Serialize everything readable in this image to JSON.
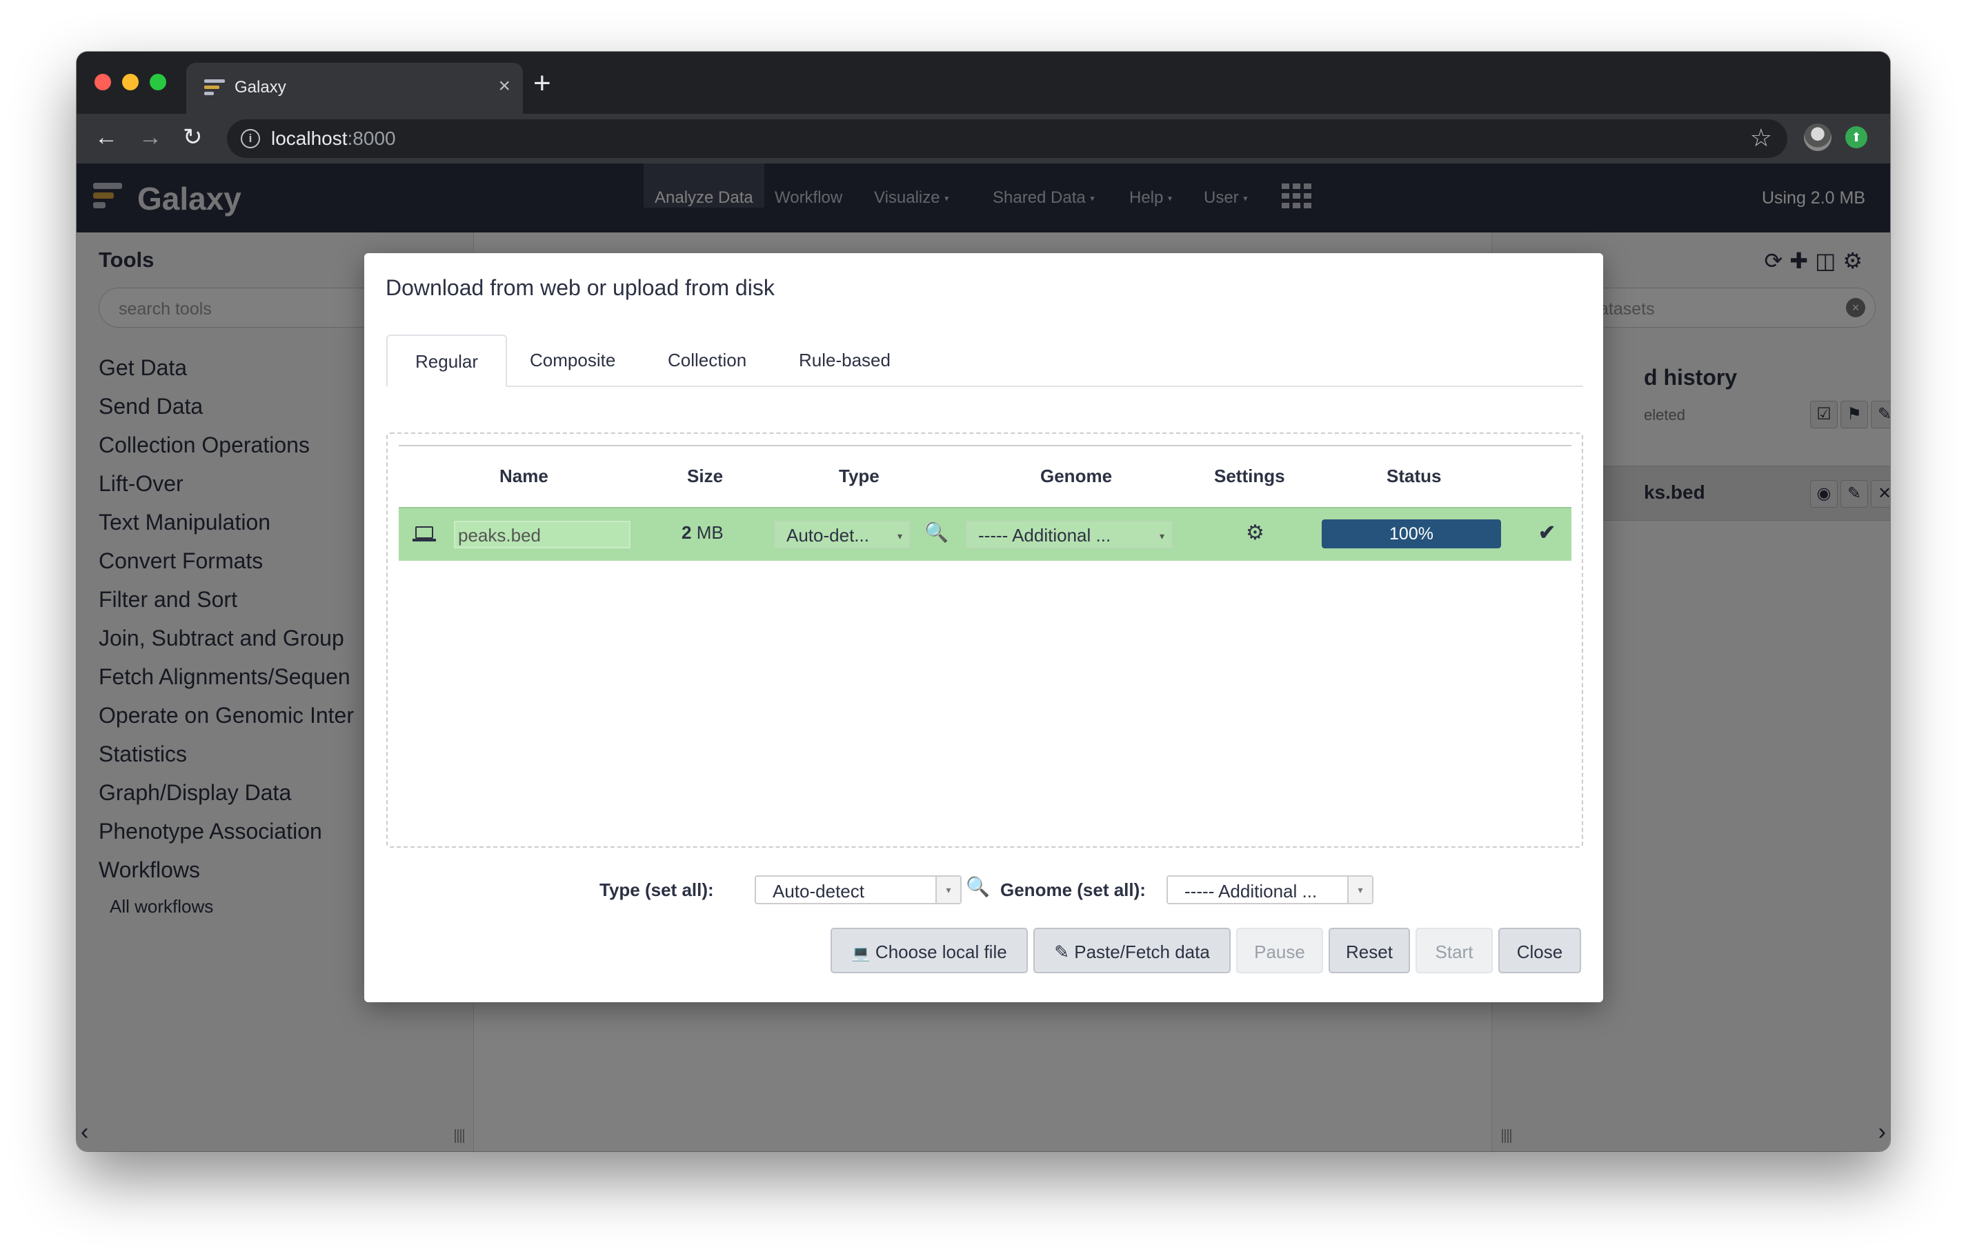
{
  "browser": {
    "tab_title": "Galaxy",
    "tab_close": "×",
    "new_tab": "+",
    "url_host": "localhost",
    "url_port": ":8000",
    "back": "←",
    "forward": "→",
    "reload": "↻",
    "info_icon": "i",
    "star": "☆",
    "ext_icon": "⬆"
  },
  "galaxy": {
    "brand": "Galaxy",
    "nav": [
      {
        "label": "Analyze Data"
      },
      {
        "label": "Workflow"
      },
      {
        "label": "Visualize"
      },
      {
        "label": "Shared Data"
      },
      {
        "label": "Help"
      },
      {
        "label": "User"
      }
    ],
    "caret": "▾",
    "quota": "Using 2.0 MB"
  },
  "tools_panel": {
    "title": "Tools",
    "search_placeholder": "search tools",
    "sections": [
      "Get Data",
      "Send Data",
      "Collection Operations",
      "Lift-Over",
      "Text Manipulation",
      "Convert Formats",
      "Filter and Sort",
      "Join, Subtract and Group",
      "Fetch Alignments/Sequen",
      "Operate on Genomic Inter",
      "Statistics",
      "Graph/Display Data",
      "Phenotype Association",
      "Workflows"
    ],
    "sub_link": "All workflows"
  },
  "history_panel": {
    "icons": "⟳✚◫⚙",
    "search_placeholder": "atasets",
    "clear": "×",
    "history_name": "d history",
    "deleted_text": "eleted",
    "action_icons": [
      "☑",
      "⚑",
      "✎"
    ],
    "dataset_name": "ks.bed",
    "dataset_icons": [
      "◉",
      "✎",
      "✕"
    ]
  },
  "footer": {
    "left_arrow": "‹",
    "right_arrow": "›"
  },
  "upload_dialog": {
    "title": "Download from web or upload from disk",
    "tabs": [
      "Regular",
      "Composite",
      "Collection",
      "Rule-based"
    ],
    "columns": [
      "Name",
      "Size",
      "Type",
      "Genome",
      "Settings",
      "Status"
    ],
    "row": {
      "name": "peaks.bed",
      "size_num": "2",
      "size_unit": " MB",
      "type": "Auto-det...",
      "genome": "----- Additional ...",
      "settings_icon": "⚙",
      "progress_percent": 100,
      "progress_label": "100%",
      "done_icon": "✔"
    },
    "type_set_all_label": "Type (set all):",
    "type_set_all_value": "Auto-detect",
    "genome_set_all_label": "Genome (set all):",
    "genome_set_all_value": "----- Additional ...",
    "select_arrow": "▾",
    "search_icon": "🔍",
    "buttons": {
      "choose_local": "Choose local file",
      "paste_fetch": "Paste/Fetch data",
      "pause": "Pause",
      "reset": "Reset",
      "start": "Start",
      "close": "Close"
    },
    "button_icons": {
      "laptop": "💻",
      "edit": "✎"
    }
  }
}
